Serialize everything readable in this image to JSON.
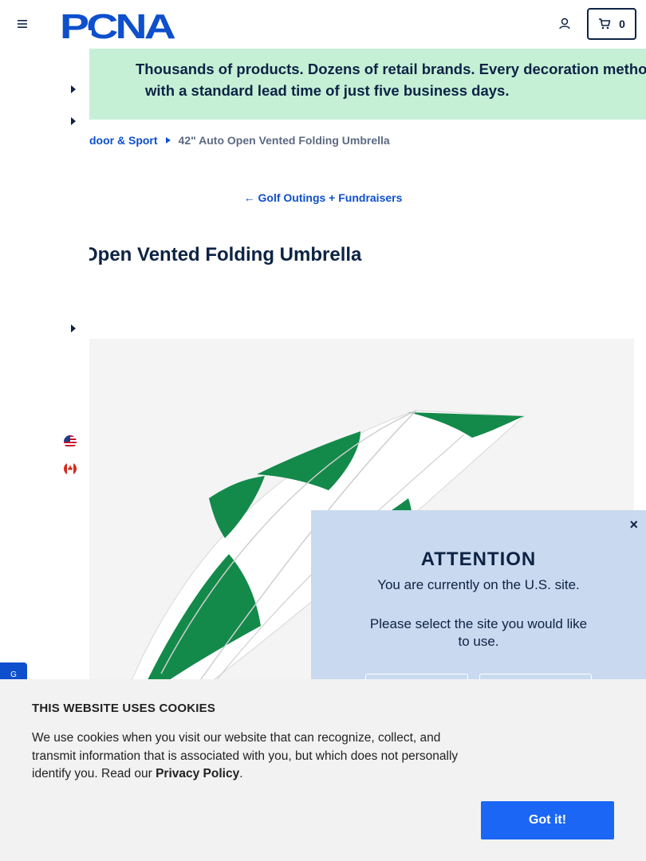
{
  "header": {
    "brand": "PCNA",
    "cart_count": "0"
  },
  "promo": {
    "line1": "Thousands of products. Dozens of retail brands. Every decoration method. All",
    "line2": "with a standard lead time of just five business days."
  },
  "breadcrumb": {
    "parent": "door & Sport",
    "current": "42\" Auto Open Vented Folding Umbrella"
  },
  "back_link": "← Golf Outings + Fundraisers",
  "product": {
    "title": "Open Vented Folding Umbrella",
    "umbrella_colors": [
      "#138a4a",
      "#ffffff"
    ]
  },
  "chat_tab": {
    "label": "G"
  },
  "modal": {
    "close": "×",
    "title": "ATTENTION",
    "line1": "You are currently on the U.S. site.",
    "line2": "Please select the site you would like to use."
  },
  "cookie": {
    "title": "THIS WEBSITE USES COOKIES",
    "body": "We use cookies when you visit our website that can recognize, collect, and transmit information that is associated with you, but which does not personally identify you. Read our ",
    "link": "Privacy Policy",
    "after_link": ".",
    "button": "Got it!"
  },
  "colors": {
    "navy": "#0d2344",
    "link_blue": "#0d4fcc",
    "promo_green": "#c6f0d6",
    "modal_bg": "#c9d9ef",
    "cookie_button": "#1b66f5"
  }
}
